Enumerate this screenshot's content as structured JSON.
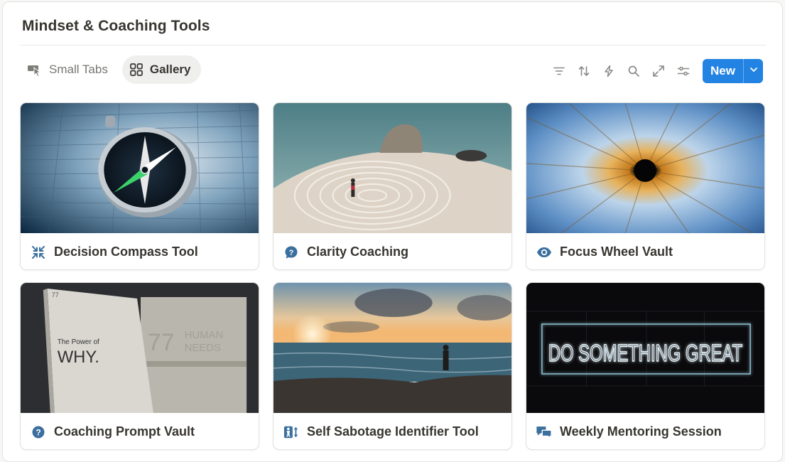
{
  "page": {
    "title": "Mindset & Coaching Tools"
  },
  "tabs": [
    {
      "label": "Small Tabs",
      "icon": "cursor-click-icon",
      "active": false
    },
    {
      "label": "Gallery",
      "icon": "gallery-grid-icon",
      "active": true
    }
  ],
  "toolbar": {
    "tools": [
      "filter-icon",
      "sort-icon",
      "lightning-icon",
      "search-icon",
      "expand-icon",
      "settings-sliders-icon"
    ],
    "new_label": "New"
  },
  "colors": {
    "accent": "#2383e2",
    "icon_blue": "#3a6f9e"
  },
  "cards": [
    {
      "title": "Decision Compass Tool",
      "icon": "compress-arrows-icon",
      "cover": "compass-on-newspaper"
    },
    {
      "title": "Clarity Coaching",
      "icon": "question-bubble-icon",
      "cover": "labyrinth-by-sea"
    },
    {
      "title": "Focus Wheel Vault",
      "icon": "eye-icon",
      "cover": "iris-closeup"
    },
    {
      "title": "Coaching Prompt Vault",
      "icon": "question-circle-icon",
      "cover": "books-power-of-why"
    },
    {
      "title": "Self Sabotage Identifier Tool",
      "icon": "person-arrows-icon",
      "cover": "sunset-beach-person"
    },
    {
      "title": "Weekly Mentoring Session",
      "icon": "chat-bubbles-icon",
      "cover": "neon-do-something-great"
    }
  ],
  "cover_text": {
    "book_number": "77",
    "book_caption": "The Power of",
    "book_title": "WHY.",
    "box_number": "77",
    "box_line1": "HUMAN",
    "box_line2": "NEEDS",
    "neon": "DO SOMETHING GREAT"
  }
}
